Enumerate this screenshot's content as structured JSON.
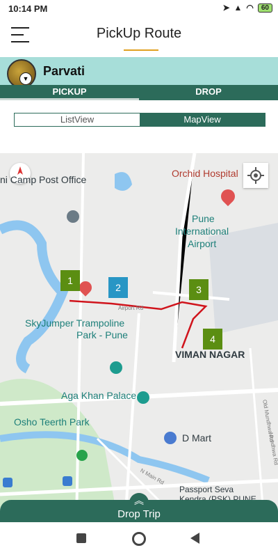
{
  "status": {
    "time": "10:14 PM",
    "battery": "60"
  },
  "header": {
    "title": "PickUp Route"
  },
  "driver": {
    "name": "Parvati"
  },
  "tabs": [
    {
      "label": "PICKUP"
    },
    {
      "label": "DROP"
    }
  ],
  "view_toggle": {
    "list_label": "ListView",
    "map_label": "MapView",
    "selected": "MapView"
  },
  "map": {
    "labels": {
      "camp_post": "ni Camp Post Office",
      "orchid": "Orchid Hospital",
      "airport_line1": "Pune",
      "airport_line2": "International",
      "airport_line3": "Airport",
      "skyjumper_line1": "SkyJumper Trampoline",
      "skyjumper_line2": "Park - Pune",
      "viman_nagar": "VIMAN NAGAR",
      "aga_khan": "Aga Khan Palace",
      "osho": "Osho Teerth Park",
      "dmart": "D Mart",
      "passport_line1": "Passport Seva",
      "passport_line2": "Kendra (PSK) PUNE",
      "airport_rd": "Airport Rd",
      "n_main_rd": "N Main Rd",
      "old_mundhwa_rd": "Old Mundhwa Rd",
      "mundhwa_rd": "Mundhwa Rd"
    },
    "markers": [
      {
        "label": "1",
        "color": "#5b8e12"
      },
      {
        "label": "2",
        "color": "#2896c5"
      },
      {
        "label": "3",
        "color": "#5b8e12"
      },
      {
        "label": "4",
        "color": "#5b8e12"
      }
    ],
    "route_color": "#d0141c"
  },
  "drop_trip": {
    "label": "Drop Trip"
  },
  "colors": {
    "primary": "#2c6b5a",
    "driver_bar": "#a7ded9",
    "accent": "#e0a020"
  }
}
